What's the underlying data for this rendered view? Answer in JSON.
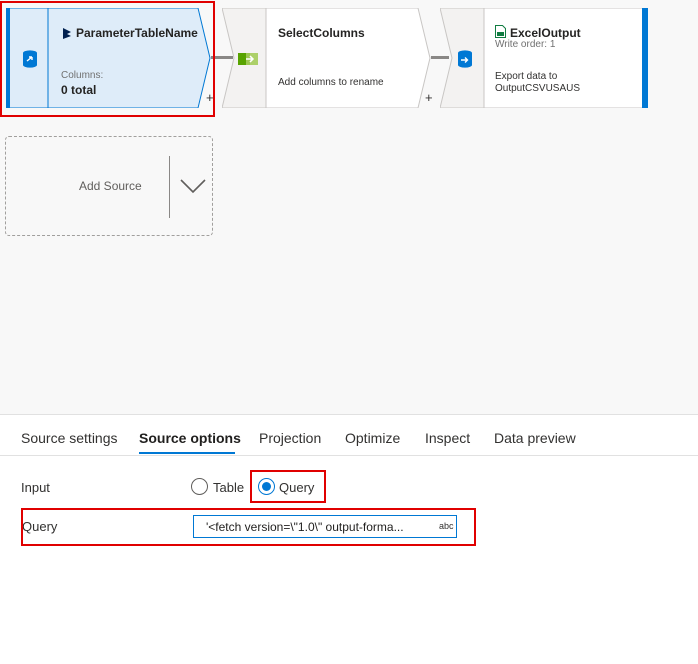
{
  "flow": {
    "source_node": {
      "title": "ParameterTableName",
      "columns_label": "Columns:",
      "columns_value": "0 total",
      "icon": "dataset-icon"
    },
    "select_node": {
      "title": "SelectColumns",
      "description": "Add columns to rename",
      "icon": "select-arrow-icon"
    },
    "sink_node": {
      "title": "ExcelOutput",
      "write_order": "Write order: 1",
      "description_line1": "Export data to",
      "description_line2": "OutputCSVUSAUS",
      "icon": "csv-file-icon"
    },
    "plus_symbol": "+",
    "add_source_label": "Add Source"
  },
  "tabs": [
    {
      "label": "Source settings",
      "active": false
    },
    {
      "label": "Source options",
      "active": true
    },
    {
      "label": "Projection",
      "active": false
    },
    {
      "label": "Optimize",
      "active": false
    },
    {
      "label": "Inspect",
      "active": false
    },
    {
      "label": "Data preview",
      "active": false
    }
  ],
  "form": {
    "input_label": "Input",
    "option_table": "Table",
    "option_query": "Query",
    "selected": "Query",
    "query_label": "Query",
    "query_value": "'<fetch version=\\\"1.0\\\" output-forma...",
    "query_badge": "abc"
  },
  "colors": {
    "accent": "#0078d4",
    "highlight": "#e00000",
    "node_selected_bg": "#deecf9"
  }
}
